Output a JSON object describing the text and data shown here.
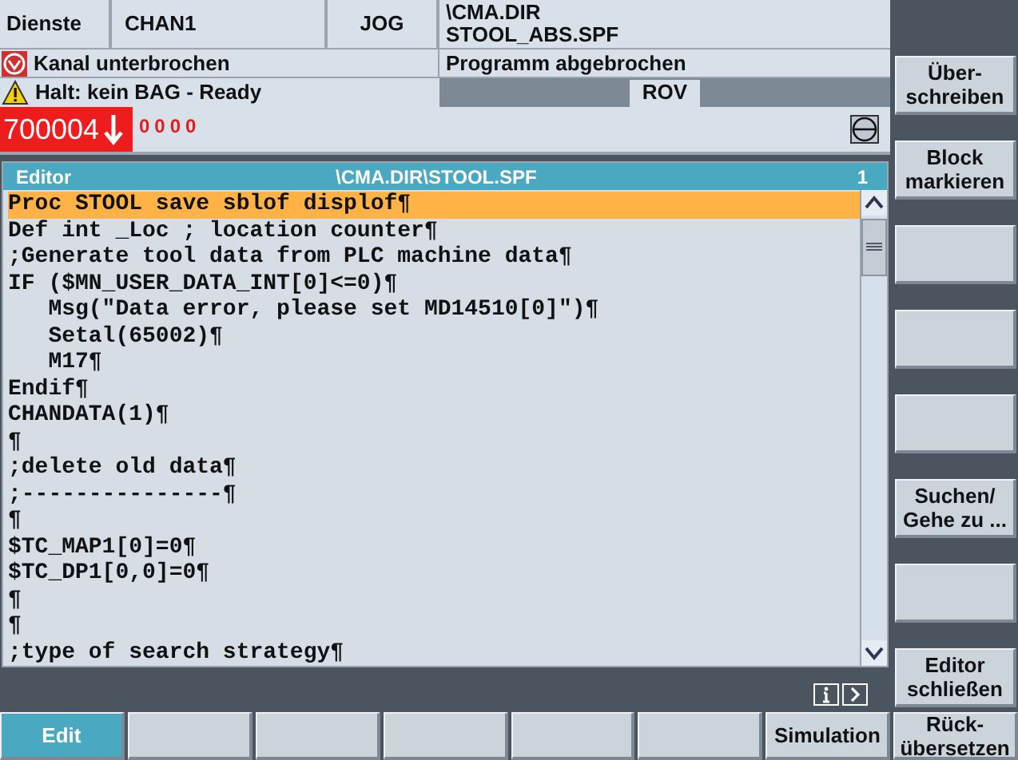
{
  "header": {
    "area": "Dienste",
    "channel": "CHAN1",
    "mode": "JOG",
    "program_path": [
      "\\CMA.DIR",
      "STOOL_ABS.SPF"
    ]
  },
  "status": {
    "channel_state": "Kanal unterbrochen",
    "program_state": "Programm abgebrochen",
    "message": "Halt: kein BAG - Ready",
    "override": "ROV"
  },
  "alarm": {
    "number": "700004",
    "counter": "0000"
  },
  "editor": {
    "title": "Editor",
    "path": "\\CMA.DIR\\STOOL.SPF",
    "line_number": "1",
    "lines": [
      {
        "text": "Proc STOOL save sblof displof¶",
        "selected": true
      },
      {
        "text": "Def int _Loc ; location counter¶",
        "selected": false
      },
      {
        "text": ";Generate tool data from PLC machine data¶",
        "selected": false
      },
      {
        "text": "IF ($MN_USER_DATA_INT[0]<=0)¶",
        "selected": false
      },
      {
        "text": "   Msg(\"Data error, please set MD14510[0]\")¶",
        "selected": false
      },
      {
        "text": "   Setal(65002)¶",
        "selected": false
      },
      {
        "text": "   M17¶",
        "selected": false
      },
      {
        "text": "Endif¶",
        "selected": false
      },
      {
        "text": "CHANDATA(1)¶",
        "selected": false
      },
      {
        "text": "¶",
        "selected": false
      },
      {
        "text": ";delete old data¶",
        "selected": false
      },
      {
        "text": ";---------------¶",
        "selected": false
      },
      {
        "text": "¶",
        "selected": false
      },
      {
        "text": "$TC_MAP1[0]=0¶",
        "selected": false
      },
      {
        "text": "$TC_DP1[0,0]=0¶",
        "selected": false
      },
      {
        "text": "¶",
        "selected": false
      },
      {
        "text": "¶",
        "selected": false
      },
      {
        "text": ";type of search strategy¶",
        "selected": false
      }
    ]
  },
  "vertical_softkeys": [
    {
      "kind": "labeled",
      "label": "Über-\nschreiben"
    },
    {
      "kind": "labeled",
      "label": "Block\nmarkieren"
    },
    {
      "kind": "blank"
    },
    {
      "kind": "blank"
    },
    {
      "kind": "blank"
    },
    {
      "kind": "labeled",
      "label": "Suchen/\nGehe zu ..."
    },
    {
      "kind": "blank"
    },
    {
      "kind": "labeled",
      "label": "Editor\nschließen"
    }
  ],
  "horizontal_softkeys": [
    {
      "label": "Edit",
      "selected": true
    },
    {
      "selected": false
    },
    {
      "selected": false
    },
    {
      "selected": false
    },
    {
      "selected": false
    },
    {
      "selected": false
    },
    {
      "label": "Simulation",
      "selected": false
    },
    {
      "label": "Rück-\nübersetzen",
      "selected": false
    }
  ]
}
